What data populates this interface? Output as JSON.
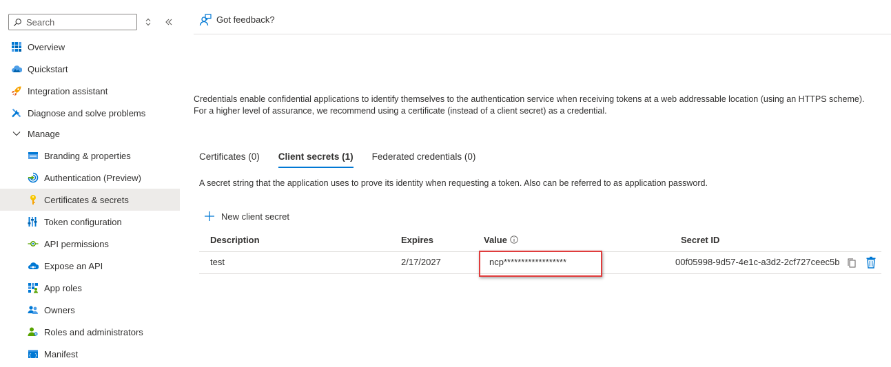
{
  "sidebar": {
    "search_placeholder": "Search",
    "items": [
      {
        "label": "Overview",
        "icon": "overview-grid-icon",
        "level": "top"
      },
      {
        "label": "Quickstart",
        "icon": "cloud-quickstart-icon",
        "level": "top"
      },
      {
        "label": "Integration assistant",
        "icon": "rocket-icon",
        "level": "top"
      },
      {
        "label": "Diagnose and solve problems",
        "icon": "wrench-icon",
        "level": "top"
      },
      {
        "label": "Manage",
        "icon": "chevron-down-icon",
        "level": "top"
      },
      {
        "label": "Branding & properties",
        "icon": "branding-icon",
        "level": "sub"
      },
      {
        "label": "Authentication (Preview)",
        "icon": "authentication-icon",
        "level": "sub"
      },
      {
        "label": "Certificates & secrets",
        "icon": "key-icon",
        "level": "sub",
        "selected": true
      },
      {
        "label": "Token configuration",
        "icon": "token-bars-icon",
        "level": "sub"
      },
      {
        "label": "API permissions",
        "icon": "api-permissions-icon",
        "level": "sub"
      },
      {
        "label": "Expose an API",
        "icon": "cloud-api-icon",
        "level": "sub"
      },
      {
        "label": "App roles",
        "icon": "app-roles-grid-icon",
        "level": "sub"
      },
      {
        "label": "Owners",
        "icon": "owners-people-icon",
        "level": "sub"
      },
      {
        "label": "Roles and administrators",
        "icon": "roles-person-icon",
        "level": "sub"
      },
      {
        "label": "Manifest",
        "icon": "manifest-icon",
        "level": "sub"
      }
    ]
  },
  "commandbar": {
    "feedback_label": "Got feedback?"
  },
  "main": {
    "intro": "Credentials enable confidential applications to identify themselves to the authentication service when receiving tokens at a web addressable location (using an HTTPS scheme). For a higher level of assurance, we recommend using a certificate (instead of a client secret) as a credential.",
    "tabs": [
      {
        "label": "Certificates (0)",
        "active": false
      },
      {
        "label": "Client secrets (1)",
        "active": true
      },
      {
        "label": "Federated credentials (0)",
        "active": false
      }
    ],
    "tab_description": "A secret string that the application uses to prove its identity when requesting a token. Also can be referred to as application password.",
    "new_secret_label": "New client secret",
    "table": {
      "columns": [
        "Description",
        "Expires",
        "Value",
        "Secret ID"
      ],
      "rows": [
        {
          "description": "test",
          "expires": "2/17/2027",
          "value": "ncp******************",
          "secret_id": "00f05998-9d57-4e1c-a3d2-2cf727ceec5b"
        }
      ]
    }
  },
  "colors": {
    "accent": "#0078d4",
    "highlight_border": "#e03c3c",
    "selected_bg": "#edebe9"
  }
}
